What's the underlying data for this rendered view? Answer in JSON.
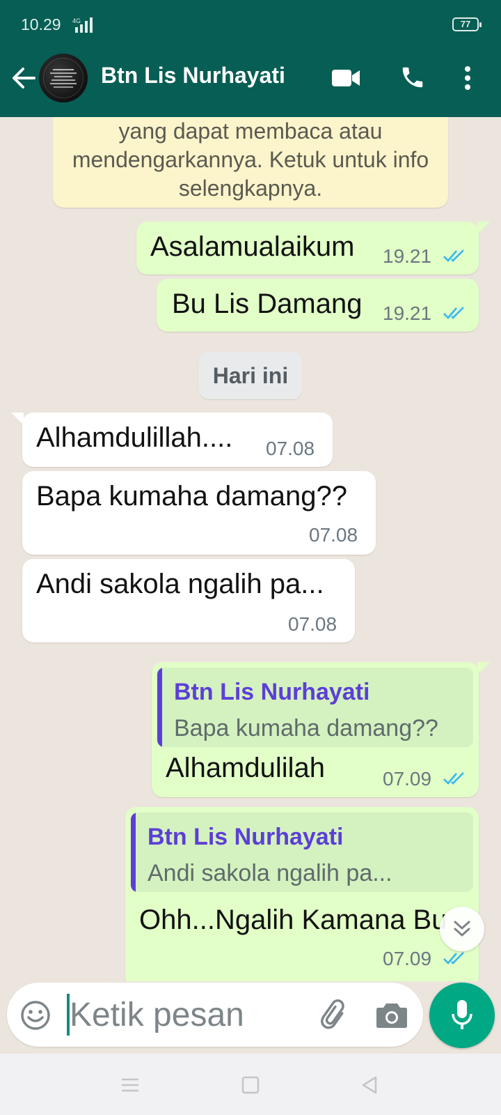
{
  "status_bar": {
    "time": "10.29",
    "network": "4G",
    "battery": "77"
  },
  "header": {
    "contact_name": "Btn Lis Nurhayati"
  },
  "encryption_notice": "yang dapat membaca atau mendengarkannya. Ketuk untuk info selengkapnya.",
  "date_separator": "Hari ini",
  "messages": [
    {
      "direction": "out",
      "text": "Asalamualaikum",
      "time": "19.21",
      "read": true
    },
    {
      "direction": "out",
      "text": "Bu Lis Damang",
      "time": "19.21",
      "read": true
    },
    {
      "direction": "in",
      "text": "Alhamdulillah....",
      "time": "07.08"
    },
    {
      "direction": "in",
      "text": "Bapa kumaha damang??",
      "time": "07.08"
    },
    {
      "direction": "in",
      "text": "Andi sakola ngalih pa...",
      "time": "07.08"
    },
    {
      "direction": "out",
      "text": "Alhamdulilah",
      "time": "07.09",
      "read": true,
      "quote": {
        "author": "Btn Lis Nurhayati",
        "text": "Bapa kumaha damang??"
      }
    },
    {
      "direction": "out",
      "text": "Ohh...Ngalih Kamana Bu",
      "time": "07.09",
      "read": true,
      "quote": {
        "author": "Btn Lis Nurhayati",
        "text": "Andi sakola ngalih pa..."
      }
    }
  ],
  "composer": {
    "placeholder": "Ketik pesan",
    "value": ""
  },
  "colors": {
    "header": "#075E54",
    "outgoing_bubble": "#E1FFC7",
    "incoming_bubble": "#FFFFFF",
    "accent": "#00A884",
    "read_tick": "#34B7F1",
    "quote_accent": "#5B3FD6"
  },
  "icons": [
    "back-arrow-icon",
    "video-call-icon",
    "voice-call-icon",
    "more-options-icon",
    "emoji-icon",
    "attach-icon",
    "camera-icon",
    "mic-icon",
    "scroll-down-icon",
    "nav-menu-icon",
    "nav-home-icon",
    "nav-back-icon"
  ]
}
